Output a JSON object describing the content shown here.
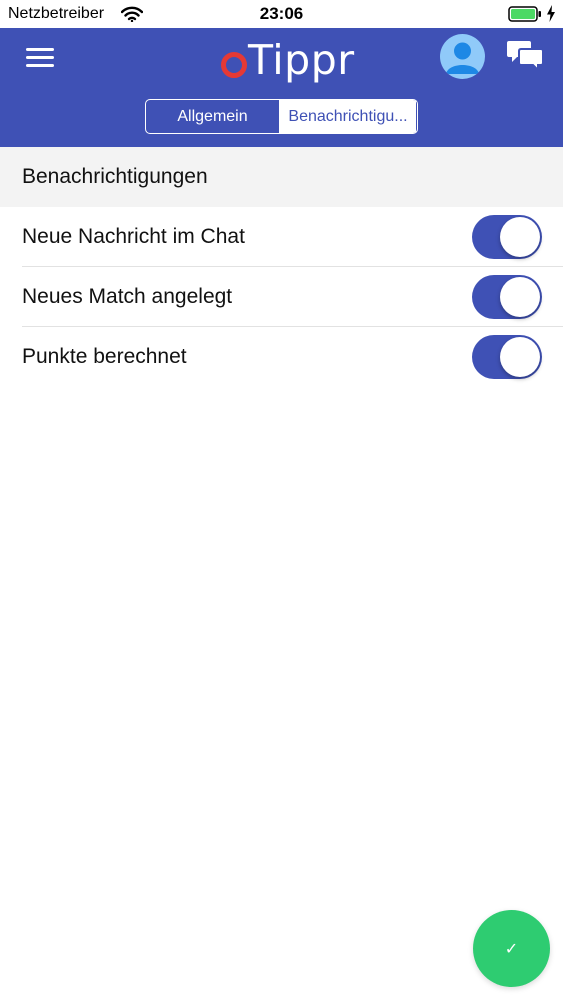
{
  "status_bar": {
    "carrier": "Netzbetreiber",
    "time": "23:06",
    "wifi_icon": "wifi-icon",
    "battery_icon": "battery-charging-icon"
  },
  "header": {
    "menu_icon": "hamburger-menu-icon",
    "logo_text": "Tippr",
    "avatar_icon": "user-avatar-icon",
    "chat_icon": "chat-bubbles-icon",
    "background_color": "#3f51b5",
    "logo_accent_color": "#e53935",
    "tabs": [
      {
        "label": "Allgemein",
        "selected": false
      },
      {
        "label": "Benachrichtigu...",
        "selected": true
      }
    ]
  },
  "section": {
    "title": "Benachrichtigungen"
  },
  "settings": [
    {
      "label": "Neue Nachricht im Chat",
      "enabled": true
    },
    {
      "label": "Neues Match angelegt",
      "enabled": true
    },
    {
      "label": "Punkte berechnet",
      "enabled": true
    }
  ],
  "fab": {
    "icon": "checkmark-icon",
    "glyph": "✓",
    "color": "#2ecc71"
  }
}
